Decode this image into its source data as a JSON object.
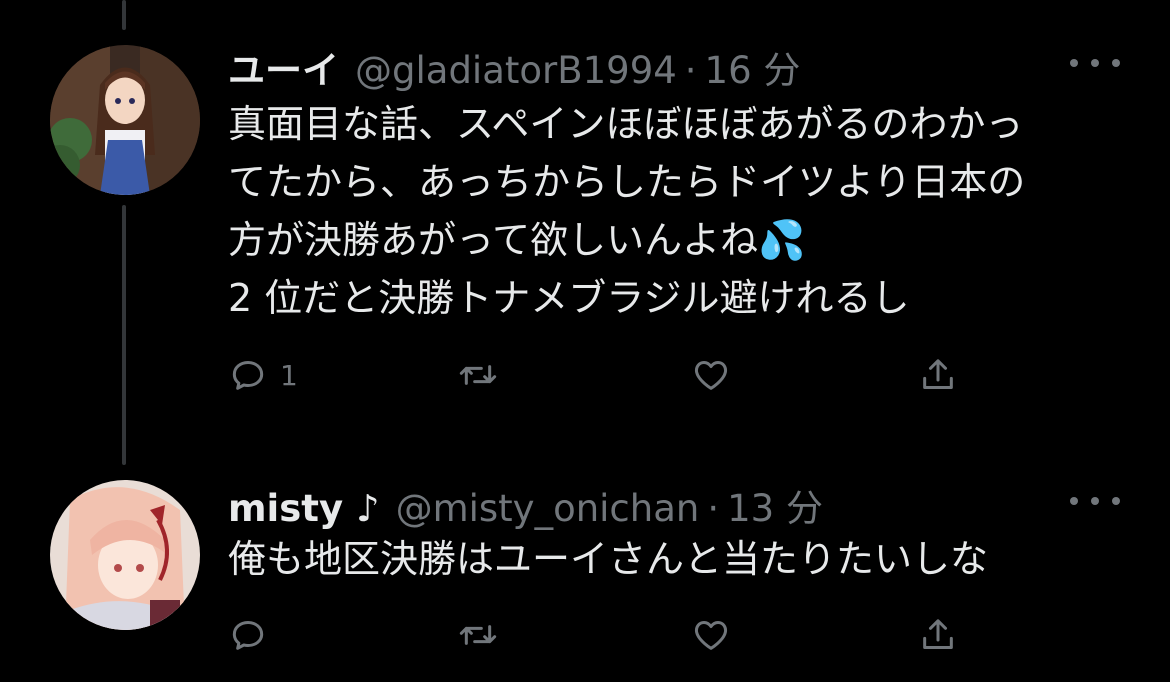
{
  "colors": {
    "background": "#000000",
    "text_primary": "#e7e9ea",
    "text_secondary": "#71767b",
    "thread_line": "#333639"
  },
  "tweets": [
    {
      "display_name": "ユーイ",
      "handle": "@gladiatorB1994",
      "separator": "·",
      "time": "16 分",
      "text": "真面目な話、スペインほぼほぼあがるのわかっ\nてたから、あっちからしたらドイツより日本の\n方が決勝あがって欲しいんよね💦\n2 位だと決勝トナメブラジル避けれるし",
      "avatar_icon": "anime-girl-avatar",
      "reply_count": "1",
      "retweet_count": "",
      "like_count": ""
    },
    {
      "display_name": "misty ♪",
      "handle": "@misty_onichan",
      "separator": "·",
      "time": "13 分",
      "text": "俺も地区決勝はユーイさんと当たりたいしな",
      "avatar_icon": "anime-girl-avatar",
      "reply_count": "",
      "retweet_count": "",
      "like_count": ""
    }
  ]
}
